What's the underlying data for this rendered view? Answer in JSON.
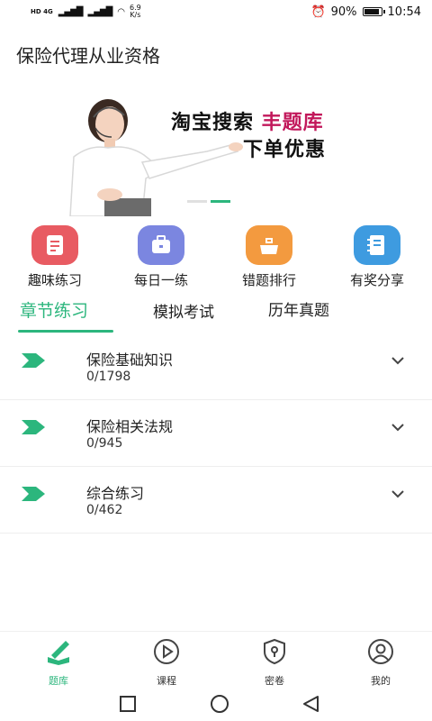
{
  "status_bar": {
    "network_left": "HD 4G",
    "speed_value": "6.9",
    "speed_unit": "K/s",
    "battery_text": "90%",
    "battery_level": 0.9,
    "time": "10:54"
  },
  "header": {
    "title": "保险代理从业资格"
  },
  "banner": {
    "line1_prefix": "淘宝搜索 ",
    "line1_highlight": "丰题库",
    "line2": "下单优惠",
    "slides": 2,
    "active_slide": 1
  },
  "quick_actions": [
    {
      "label": "趣味练习",
      "icon": "quiz-sheet-icon",
      "color": "#e85b62"
    },
    {
      "label": "每日一练",
      "icon": "toolbox-icon",
      "color": "#7b86e0"
    },
    {
      "label": "错题排行",
      "icon": "ranking-tray-icon",
      "color": "#f39a3f"
    },
    {
      "label": "有奖分享",
      "icon": "notebook-icon",
      "color": "#3e9be0"
    }
  ],
  "tabs": [
    {
      "label": "章节练习",
      "active": true
    },
    {
      "label": "模拟考试",
      "active": false
    },
    {
      "label": "历年真题",
      "active": false
    }
  ],
  "chapters": [
    {
      "name": "保险基础知识",
      "progress": "0/1798"
    },
    {
      "name": "保险相关法规",
      "progress": "0/945"
    },
    {
      "name": "综合练习",
      "progress": "0/462"
    }
  ],
  "bottom_nav": [
    {
      "label": "题库",
      "active": true
    },
    {
      "label": "课程",
      "active": false
    },
    {
      "label": "密卷",
      "active": false
    },
    {
      "label": "我的",
      "active": false
    }
  ],
  "colors": {
    "accent": "#2cb67d",
    "highlight": "#c2185b"
  }
}
